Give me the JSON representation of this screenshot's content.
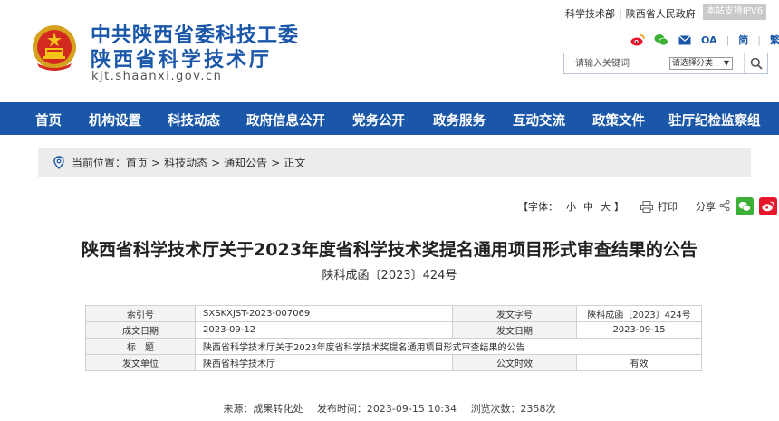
{
  "header": {
    "org_name_1": "中共陕西省委科技工委",
    "org_name_2": "陕西省科学技术厅",
    "domain": "kjt.shaanxi.gov.cn",
    "top_links": [
      "科学技术部",
      "陕西省人民政府"
    ],
    "ipv6_label": "本站支持IPV6",
    "social": {
      "oa_label": "OA",
      "simplified_label": "简",
      "traditional_label": "繁"
    },
    "search": {
      "placeholder": "请输入关键词",
      "select_value": "请选择分类"
    }
  },
  "nav": {
    "items": [
      "首页",
      "机构设置",
      "科技动态",
      "政府信息公开",
      "党务公开",
      "政务服务",
      "互动交流",
      "政策文件",
      "驻厅纪检监察组"
    ]
  },
  "breadcrumb": {
    "prefix": "当前位置：",
    "items": [
      "首页",
      "科技动态",
      "通知公告",
      "正文"
    ]
  },
  "tools": {
    "font_label": "【字体：",
    "sizes": [
      "小",
      "中",
      "大"
    ],
    "font_close": "】",
    "print_label": "打印",
    "share_label": "分享"
  },
  "article": {
    "title": "陕西省科学技术厅关于2023年度省科学技术奖提名通用项目形式审查结果的公告",
    "doc_number": "陕科成函〔2023〕424号",
    "info": {
      "index_label": "索引号",
      "index_value": "SXSKXJST-2023-007069",
      "doc_no_label": "发文字号",
      "doc_no_value": "陕科成函〔2023〕424号",
      "created_label": "成文日期",
      "created_value": "2023-09-12",
      "issued_label": "发文日期",
      "issued_value": "2023-09-15",
      "title_label": "标　题",
      "title_value": "陕西省科学技术厅关于2023年度省科学技术奖提名通用项目形式审查结果的公告",
      "unit_label": "发文单位",
      "unit_value": "陕西省科学技术厅",
      "validity_label": "公文时效",
      "validity_value": "有效"
    },
    "meta": {
      "source": "来源：成果转化处",
      "publish_time": "发布时间：2023-09-15 10:34",
      "views": "浏览次数：2358次"
    }
  },
  "colors": {
    "brand_blue": "#1a57a8",
    "wechat_green": "#3cb034",
    "weibo_red": "#e6162d"
  }
}
